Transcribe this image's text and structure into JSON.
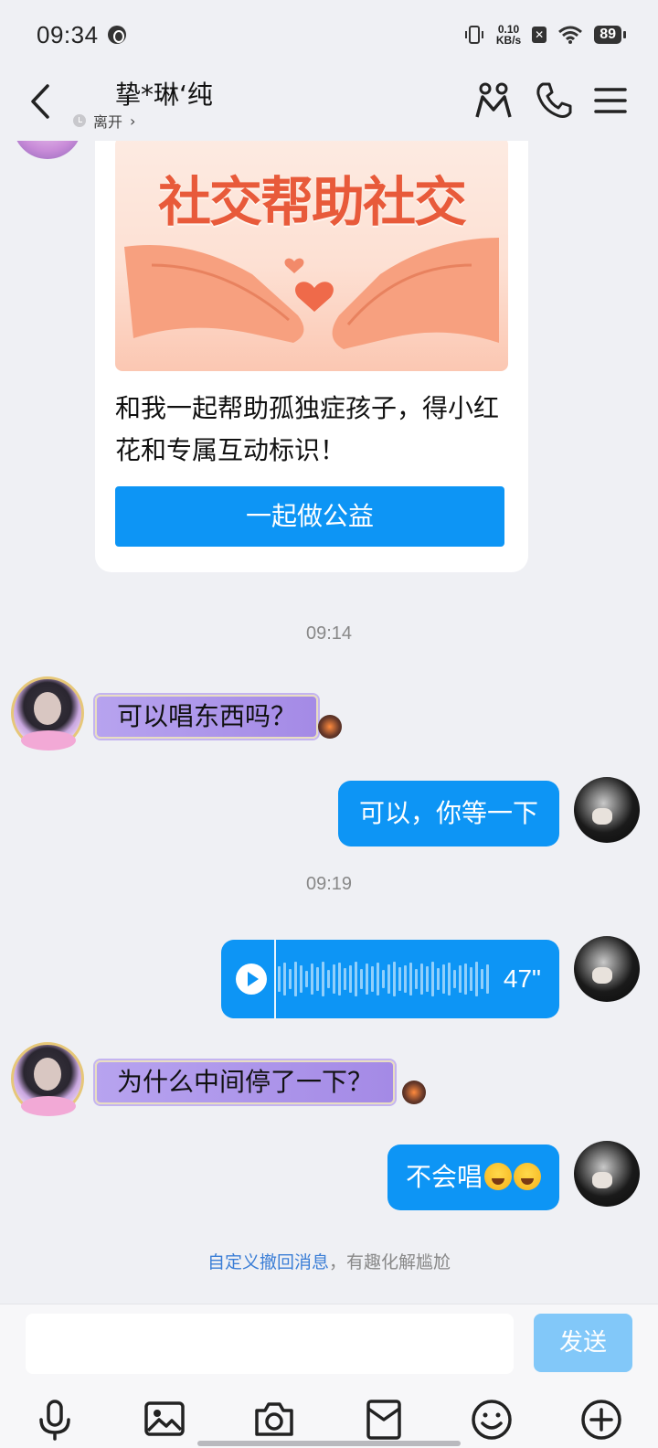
{
  "status_bar": {
    "time": "09:34",
    "net_speed_value": "0.10",
    "net_speed_unit": "KB/s",
    "battery": "89"
  },
  "header": {
    "title": "挚*琳‘纯",
    "presence": "离开",
    "presence_chevron": "›"
  },
  "card": {
    "banner_title": "社交帮助社交",
    "text": "和我一起帮助孤独症孩子，得小红花和专属互动标识！",
    "button_label": "一起做公益"
  },
  "messages": {
    "time_1": "09:14",
    "left_1": "可以唱东西吗？",
    "right_1": "可以，你等一下",
    "time_2": "09:19",
    "voice_duration": "47\"",
    "left_2": "为什么中间停了一下？",
    "right_2": "不会唱"
  },
  "recall_hint": {
    "link": "自定义撤回消息",
    "rest": "，有趣化解尴尬"
  },
  "input": {
    "value": "",
    "send_label": "发送"
  },
  "icons": {
    "back": "chevron-left-icon",
    "group": "people-icon",
    "call": "phone-icon",
    "menu": "menu-icon",
    "voice": "microphone-icon",
    "image": "image-icon",
    "camera": "camera-icon",
    "redpacket": "red-packet-icon",
    "emoji": "emoji-icon",
    "plus": "plus-circle-icon"
  },
  "colors": {
    "accent": "#0d95f5",
    "send_disabled": "#82c8f9",
    "bubble_left": "#a890e8",
    "link": "#3b7ed6"
  }
}
